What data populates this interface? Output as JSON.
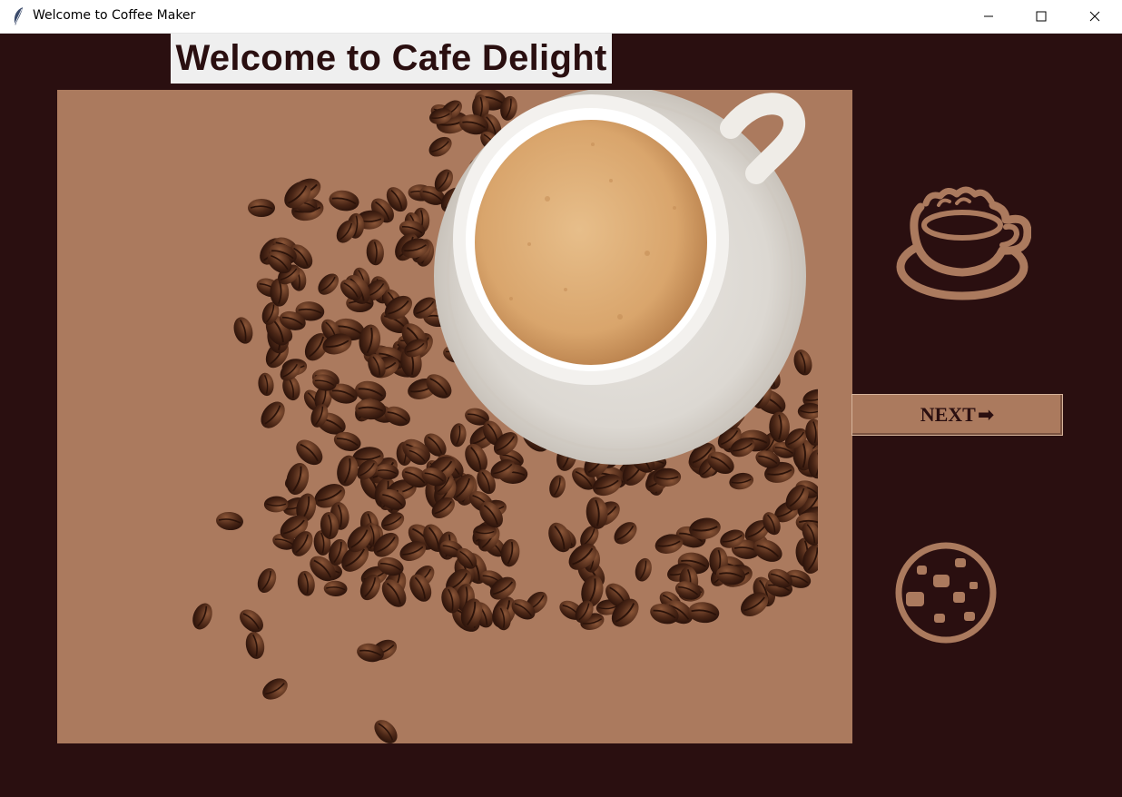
{
  "window": {
    "title": "Welcome to Coffee Maker",
    "icon": "feather-icon",
    "controls": [
      "minimize-icon",
      "maximize-icon",
      "close-icon"
    ]
  },
  "main": {
    "heading": "Welcome to Cafe Delight",
    "hero_image": "coffee-cup-with-beans",
    "next_button": {
      "label": "NEXT",
      "icon": "arrow-right-icon",
      "arrow": "➡"
    },
    "side_icons": [
      "coffee-cup-icon",
      "cookie-icon"
    ]
  },
  "colors": {
    "background": "#2a0f10",
    "accent": "#ab7a5e",
    "heading_bg": "#efefef",
    "text_dark": "#2a0f10"
  }
}
